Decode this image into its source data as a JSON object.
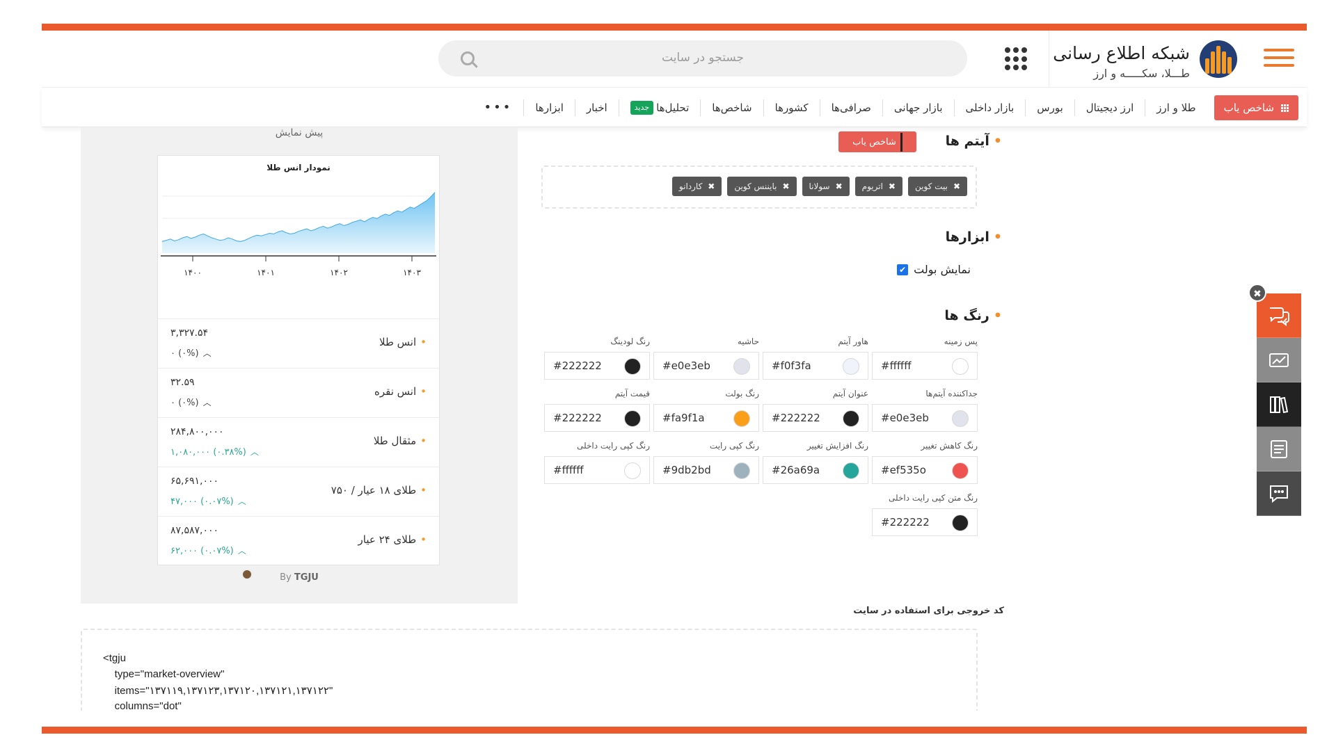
{
  "header": {
    "site_title": "شبکه اطلاع رسانی",
    "site_subtitle": "طـــلا، سکـــــه و ارز",
    "search_placeholder": "جستجو در سایت",
    "icons": [
      "menu-icon",
      "apps-grid-icon",
      "search-icon"
    ]
  },
  "nav": {
    "cta_label": "شاخص یاب",
    "items": [
      "طلا و ارز",
      "ارز دیجیتال",
      "بورس",
      "بازار داخلی",
      "بازار جهانی",
      "صرافی‌ها",
      "کشورها",
      "شاخص‌ها",
      "تحلیل‌ها",
      "اخبار",
      "ابزارها"
    ],
    "new_badge": "جدید",
    "more": "•••"
  },
  "preview": {
    "title": "پیش نمایش",
    "chart_title": "نمودار انس طلا",
    "x_ticks": [
      "۱۴۰۰",
      "۱۴۰۱",
      "۱۴۰۲",
      "۱۴۰۳"
    ],
    "rows": [
      {
        "name": "انس طلا",
        "price": "۳,۳۲۷.۵۴",
        "change": "۰ (۰%)",
        "trend": "up",
        "color": "neutral"
      },
      {
        "name": "انس نقره",
        "price": "۳۲.۵۹",
        "change": "۰ (۰%)",
        "trend": "up",
        "color": "neutral"
      },
      {
        "name": "مثقال طلا",
        "price": "۲۸۴,۸۰۰,۰۰۰",
        "change": "۱,۰۸۰,۰۰۰ (۰.۳۸%)",
        "trend": "up",
        "color": "up"
      },
      {
        "name": "طلای ۱۸ عیار / ۷۵۰",
        "price": "۶۵,۶۹۱,۰۰۰",
        "change": "۴۷,۰۰۰ (۰.۰۷%)",
        "trend": "up",
        "color": "up"
      },
      {
        "name": "طلای ۲۴ عیار",
        "price": "۸۷,۵۸۷,۰۰۰",
        "change": "۶۲,۰۰۰ (۰.۰۷%)",
        "trend": "up",
        "color": "up"
      }
    ],
    "by_prefix": "By",
    "by_brand": "TGJU"
  },
  "chart_data": {
    "type": "area",
    "title": "نمودار انس طلا",
    "x_ticks": [
      "۱۴۰۰",
      "۱۴۰۱",
      "۱۴۰۲",
      "۱۴۰۳"
    ],
    "ylim": [
      0,
      100
    ],
    "values": [
      18,
      20,
      22,
      19,
      21,
      24,
      26,
      23,
      25,
      28,
      30,
      27,
      24,
      22,
      20,
      21,
      24,
      22,
      19,
      18,
      20,
      23,
      26,
      28,
      27,
      29,
      31,
      30,
      33,
      35,
      32,
      30,
      31,
      34,
      36,
      38,
      35,
      37,
      40,
      42,
      39,
      41,
      44,
      46,
      43,
      45,
      48,
      50,
      52,
      49,
      53,
      56,
      54,
      58,
      61,
      59,
      63,
      66,
      64,
      68,
      72,
      70,
      74,
      78,
      82,
      88,
      95
    ],
    "fill_top": "#6fc3f2",
    "fill_bottom": "#e8f6fd",
    "line_color": "#42a8e6"
  },
  "settings": {
    "items_heading": "آیتم ها",
    "finder_button": "شاخص یاب",
    "tags": [
      "بیت کوین",
      "اتریوم",
      "سولانا",
      "بایننس کوین",
      "کاردانو"
    ],
    "tools_heading": "ابزارها",
    "show_bullet_label": "نمایش بولت",
    "show_bullet_checked": true,
    "colors_heading": "رنگ ها",
    "color_fields": [
      {
        "label": "پس زمینه",
        "value": "#ffffff",
        "swatch": "#ffffff"
      },
      {
        "label": "هاور آیتم",
        "value": "#f0f3fa",
        "swatch": "#f0f3fa"
      },
      {
        "label": "حاشیه",
        "value": "#e0e3eb",
        "swatch": "#e0e3eb"
      },
      {
        "label": "رنگ لودینگ",
        "value": "#222222",
        "swatch": "#222222"
      },
      {
        "label": "جداکننده آیتم‌ها",
        "value": "#e0e3eb",
        "swatch": "#e0e3eb"
      },
      {
        "label": "عنوان آیتم",
        "value": "#222222",
        "swatch": "#222222"
      },
      {
        "label": "رنگ بولت",
        "value": "#fa9f1a",
        "swatch": "#fa9f1a"
      },
      {
        "label": "قیمت آیتم",
        "value": "#222222",
        "swatch": "#222222"
      },
      {
        "label": "رنگ کاهش تغییر",
        "value": "#ef535o",
        "swatch": "#ef5350"
      },
      {
        "label": "رنگ افزایش تغییر",
        "value": "#26a69a",
        "swatch": "#26a69a"
      },
      {
        "label": "رنگ کپی رایت",
        "value": "#9db2bd",
        "swatch": "#9db2bd"
      },
      {
        "label": "رنگ کپی رایت داخلی",
        "value": "#ffffff",
        "swatch": "#ffffff"
      },
      {
        "label": "رنگ متن کپی رایت داخلی",
        "value": "#222222",
        "swatch": "#222222"
      }
    ],
    "output_label": "کد خروجی برای استفاده در سایت",
    "code_lines": [
      "<tgju",
      "    type=\"market-overview\"",
      "    items=\"۱۳۷۱۱۹,۱۳۷۱۲۳,۱۳۷۱۲۰,۱۳۷۱۲۱,۱۳۷۱۲۲\"",
      "    columns=\"dot\""
    ]
  },
  "floating": {
    "close": "✖",
    "buttons": [
      "help-chat-icon",
      "chart-compare-icon",
      "library-icon",
      "notes-icon",
      "message-icon"
    ],
    "colors": [
      "#ea5a2d",
      "#8b8b8b",
      "#222222",
      "#8b8b8b",
      "#4a4a4a"
    ]
  },
  "colors": {
    "accent": "#ea5a2d",
    "cta": "#e85e55",
    "up": "#2aa693"
  }
}
